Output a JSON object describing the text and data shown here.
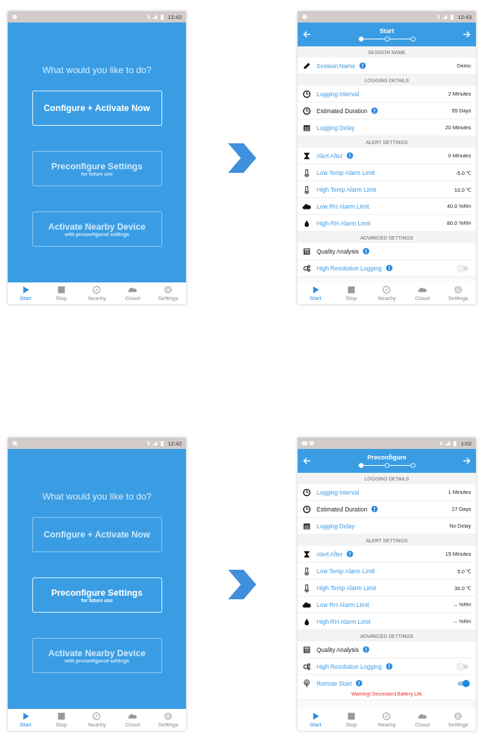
{
  "flows": [
    {
      "home": {
        "time": "12:42",
        "question": "What would you like to do?",
        "options": [
          {
            "title": "Configure + Activate Now",
            "selected": true
          },
          {
            "title": "Preconfigure Settings",
            "subtitle": "for future use",
            "selected": false
          },
          {
            "title": "Activate Nearby Device",
            "subtitle": "with preconfigured settings",
            "selected": false
          }
        ],
        "nav": [
          {
            "label": "Start",
            "selected": true
          },
          {
            "label": "Stop",
            "selected": false
          },
          {
            "label": "Nearby",
            "selected": false
          },
          {
            "label": "Cloud",
            "selected": false
          },
          {
            "label": "Settings",
            "selected": false
          }
        ]
      },
      "settings": {
        "time": "12:43",
        "title": "Start",
        "steps": [
          {
            "selected": true
          },
          {
            "selected": false
          },
          {
            "selected": false
          }
        ],
        "sections": [
          {
            "heading": "SESSION NAME",
            "rows": [
              {
                "kind": "name",
                "label": "Session Name",
                "editable": true,
                "info": true,
                "value": "Demo"
              }
            ]
          },
          {
            "heading": "LOGGING DETAILS",
            "rows": [
              {
                "kind": "interval",
                "label": "Logging Interval",
                "editable": true,
                "info": false,
                "value": "2 Minutes"
              },
              {
                "kind": "duration",
                "label": "Estimated Duration",
                "editable": false,
                "info": true,
                "value": "55 Days"
              },
              {
                "kind": "delay",
                "label": "Logging Delay",
                "editable": true,
                "info": false,
                "value": "20 Minutes"
              }
            ]
          },
          {
            "heading": "ALERT SETTINGS",
            "rows": [
              {
                "kind": "alert",
                "label": "Alert After",
                "editable": true,
                "info": true,
                "value": "0 Minutes"
              },
              {
                "kind": "temperature",
                "label": "Low Temp Alarm Limit",
                "editable": true,
                "info": false,
                "value": "-5.0 ℃"
              },
              {
                "kind": "temperature",
                "label": "High Temp Alarm Limit",
                "editable": true,
                "info": false,
                "value": "10.0 ℃"
              },
              {
                "kind": "humidity-low",
                "label": "Low RH Alarm Limit",
                "editable": true,
                "info": false,
                "value": "40.0 %RH"
              },
              {
                "kind": "humidity-high",
                "label": "High RH Alarm Limit",
                "editable": true,
                "info": false,
                "value": "80.0 %RH"
              }
            ]
          },
          {
            "heading": "ADVANCED SETTINGS",
            "rows": [
              {
                "kind": "analysis",
                "label": "Quality Analysis",
                "editable": false,
                "info": true
              },
              {
                "kind": "resolution",
                "label": "High Resolution Logging",
                "editable": true,
                "info": true,
                "on": false
              }
            ]
          }
        ],
        "nav": [
          {
            "label": "Start",
            "selected": true
          },
          {
            "label": "Stop",
            "selected": false
          },
          {
            "label": "Nearby",
            "selected": false
          },
          {
            "label": "Cloud",
            "selected": false
          },
          {
            "label": "Settings",
            "selected": false
          }
        ]
      }
    },
    {
      "home": {
        "time": "12:42",
        "question": "What would you like to do?",
        "options": [
          {
            "title": "Configure + Activate Now",
            "selected": false
          },
          {
            "title": "Preconfigure Settings",
            "subtitle": "for future use",
            "selected": true
          },
          {
            "title": "Activate Nearby Device",
            "subtitle": "with preconfigured settings",
            "selected": false
          }
        ],
        "nav": [
          {
            "label": "Start",
            "selected": true
          },
          {
            "label": "Stop",
            "selected": false
          },
          {
            "label": "Nearby",
            "selected": false
          },
          {
            "label": "Cloud",
            "selected": false
          },
          {
            "label": "Settings",
            "selected": false
          }
        ]
      },
      "settings": {
        "time": "1:02",
        "title": "Preconfigure",
        "steps": [
          {
            "selected": true
          },
          {
            "selected": false
          },
          {
            "selected": false
          }
        ],
        "sections": [
          {
            "heading": "LOGGING DETAILS",
            "rows": [
              {
                "kind": "interval",
                "label": "Logging Interval",
                "editable": true,
                "info": false,
                "value": "1 Minutes"
              },
              {
                "kind": "duration",
                "label": "Estimated Duration",
                "editable": false,
                "info": true,
                "value": "27 Days"
              },
              {
                "kind": "delay",
                "label": "Logging Delay",
                "editable": true,
                "info": false,
                "value": "No Delay"
              }
            ]
          },
          {
            "heading": "ALERT SETTINGS",
            "rows": [
              {
                "kind": "alert",
                "label": "Alert After",
                "editable": true,
                "info": true,
                "value": "15 Minutes"
              },
              {
                "kind": "temperature",
                "label": "Low Temp Alarm Limit",
                "editable": true,
                "info": false,
                "value": "5.0 ℃"
              },
              {
                "kind": "temperature",
                "label": "High Temp Alarm Limit",
                "editable": true,
                "info": false,
                "value": "30.0 ℃"
              },
              {
                "kind": "humidity-low",
                "label": "Low RH Alarm Limit",
                "editable": true,
                "info": false,
                "value": "-- %RH"
              },
              {
                "kind": "humidity-high",
                "label": "High RH Alarm Limit",
                "editable": true,
                "info": false,
                "value": "-- %RH"
              }
            ]
          },
          {
            "heading": "ADVANCED SETTINGS",
            "rows": [
              {
                "kind": "analysis",
                "label": "Quality Analysis",
                "editable": false,
                "info": true
              },
              {
                "kind": "resolution",
                "label": "High Resolution Logging",
                "editable": true,
                "info": true,
                "on": false
              },
              {
                "kind": "remote",
                "label": "Remote Start",
                "editable": true,
                "info": true,
                "on": true,
                "warning": "Warning! Decreased Battery Life"
              }
            ]
          }
        ],
        "nav": [
          {
            "label": "Start",
            "selected": true
          },
          {
            "label": "Stop",
            "selected": false
          },
          {
            "label": "Nearby",
            "selected": false
          },
          {
            "label": "Cloud",
            "selected": false
          },
          {
            "label": "Settings",
            "selected": false
          }
        ]
      }
    }
  ]
}
